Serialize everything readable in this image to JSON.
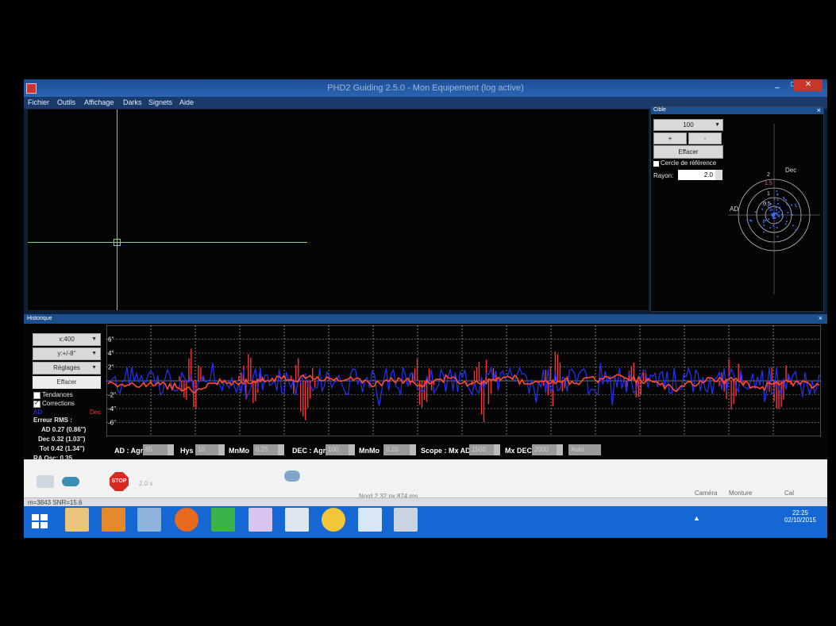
{
  "window": {
    "title": "PHD2 Guiding 2.5.0 - Mon Equipement (log active)",
    "min": "_",
    "max": "□",
    "close": "✕"
  },
  "menu": [
    "Fichier",
    "Outils",
    "Affichage",
    "Darks",
    "Signets",
    "Aide"
  ],
  "target_panel": {
    "title": "Cible",
    "close": "×",
    "zoom": "100",
    "plus": "+",
    "minus": "-",
    "effacer": "Effacer",
    "cercle_ref": "Cercle de référence",
    "rayon_label": "Rayon:",
    "rayon_value": "2.0",
    "axis_ad": "AD",
    "axis_dec": "Dec",
    "ring_labels": [
      "2",
      "1.5",
      "1",
      "0.5"
    ]
  },
  "history_panel": {
    "title": "Historique",
    "close": "×",
    "x_scale": "x:400",
    "y_scale": "y:+/-8''",
    "reglages": "Réglages",
    "effacer": "Effacer",
    "tendances": "Tendances",
    "corrections": "Corrections",
    "legend_ad": "AD",
    "legend_dec": "Dec",
    "rms_title": "Erreur RMS :",
    "rms_ad": "AD 0.27 (0.86'')",
    "rms_dec": "Dec 0.32 (1.03'')",
    "rms_tot": "Tot 0.42 (1.34'')",
    "ra_osc": "RA Osc: 0.35",
    "y_ticks": [
      "6''",
      "4''",
      "2''",
      "-2''",
      "-4''",
      "-6''"
    ]
  },
  "controls": {
    "ad_agr_label": "AD : Agr",
    "ad_agr": "85",
    "hys_label": "Hys",
    "hys": "10",
    "mnmo_label": "MnMo",
    "mnmo": "0.25",
    "dec_agr_label": "DEC : Agr",
    "dec_agr": "100",
    "mnmo2_label": "MnMo",
    "mnmo2": "0.20",
    "scope_label": "Scope : Mx AD",
    "mx_ad": "1500",
    "mx_dec_label": "Mx DEC",
    "mx_dec": "2000",
    "mode": "Auto"
  },
  "toolbar": {
    "stop": "STOP",
    "exposure": "2.0 s",
    "star_info": "Nord 2.32 px 874 ms",
    "camera": "Caméra",
    "monture": "Monture",
    "cal": "Cal"
  },
  "status": {
    "text": "m=3843 SNR=15.6"
  },
  "taskbar": {
    "tray": "▲",
    "time": "22:25",
    "date": "02/10/2015"
  },
  "colors": {
    "ra": "#2233ff",
    "dec": "#ff3333",
    "ra_correction": "#ff3333",
    "crosshair": "#7ce33a",
    "titlebar": "#2b64b4"
  }
}
